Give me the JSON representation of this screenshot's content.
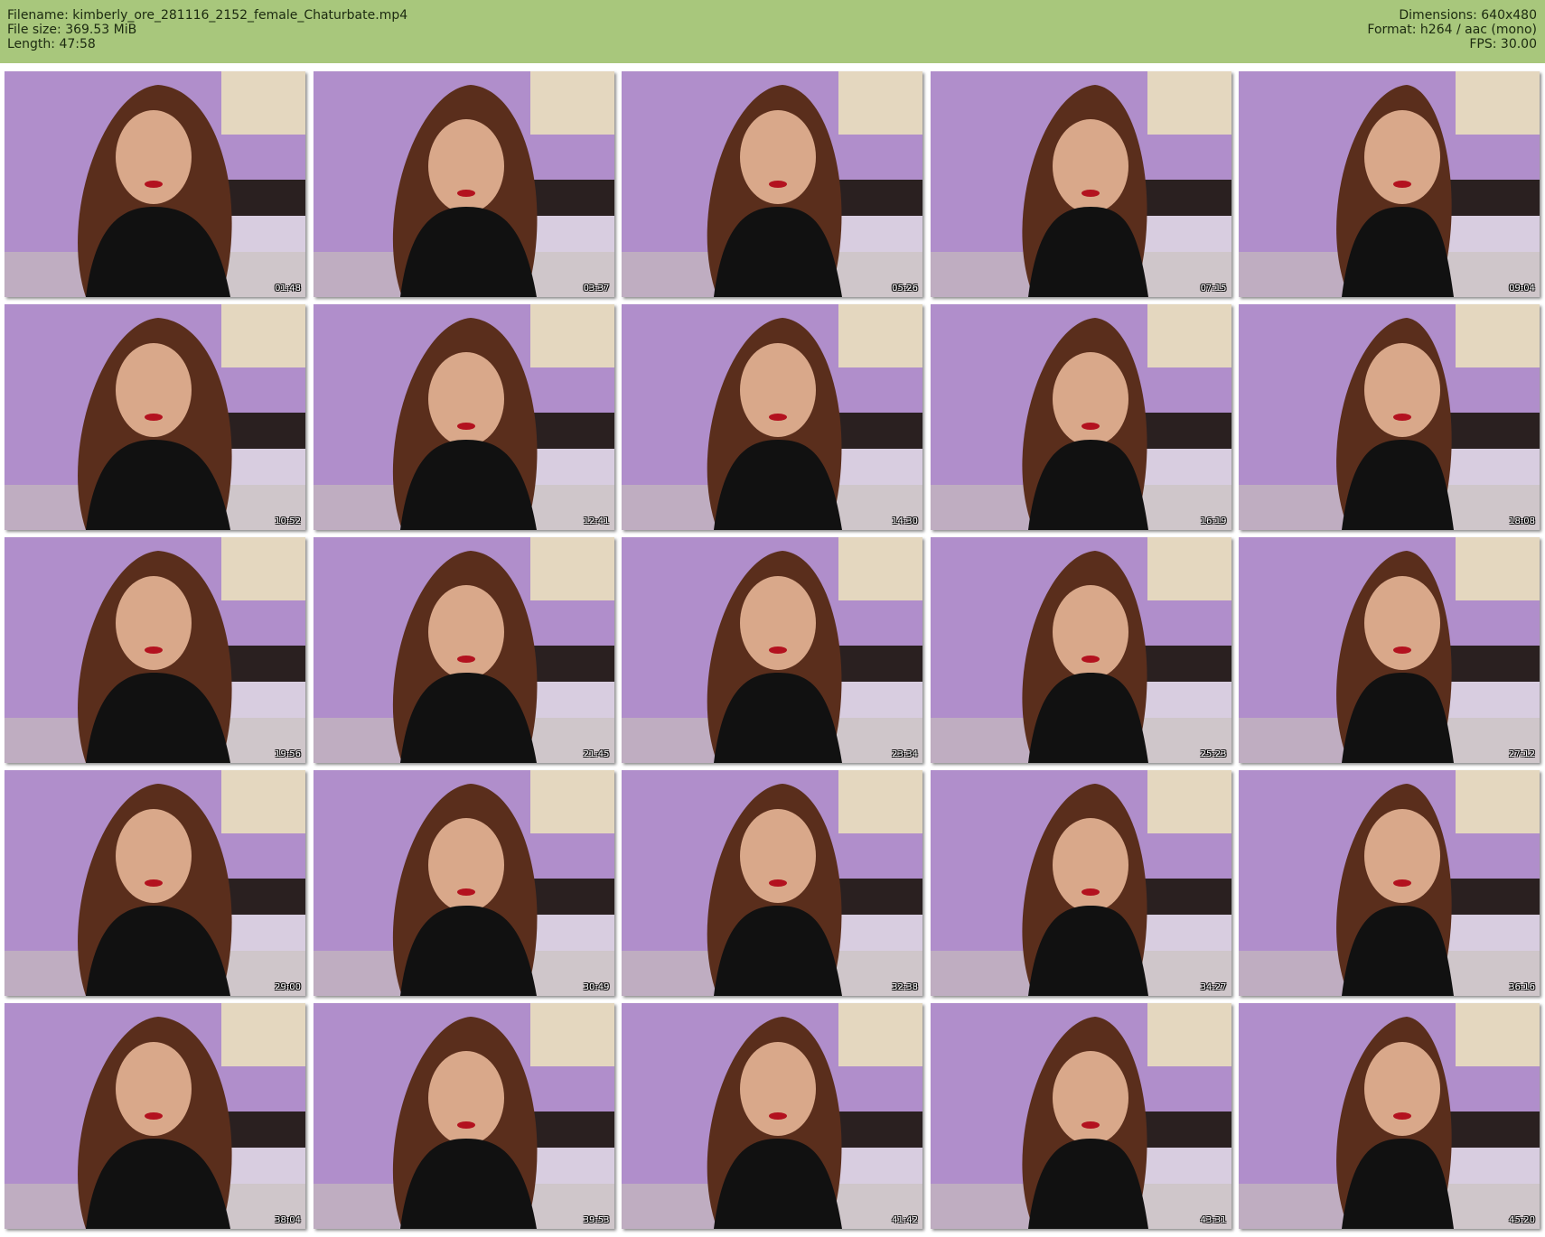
{
  "file_info": {
    "filename_line": "Filename: kimberly_ore_281116_2152_female_Chaturbate.mp4",
    "filesize_line": "File size: 369.53 MiB",
    "length_line": "Length: 47:58",
    "dimensions_line": "Dimensions: 640x480",
    "format_line": "Format: h264 / aac (mono)",
    "fps_line": "FPS: 30.00"
  },
  "colors": {
    "header_bg": "#a8c77c",
    "page_bg": "#ffffff",
    "wall": "#b08ecb",
    "hair": "#5a2e1c",
    "shirt": "#111111"
  },
  "thumbnails": [
    {
      "time": "01:48"
    },
    {
      "time": "03:37"
    },
    {
      "time": "05:26"
    },
    {
      "time": "07:15"
    },
    {
      "time": "09:04"
    },
    {
      "time": "10:52"
    },
    {
      "time": "12:41"
    },
    {
      "time": "14:30"
    },
    {
      "time": "16:19"
    },
    {
      "time": "18:08"
    },
    {
      "time": "19:56"
    },
    {
      "time": "21:45"
    },
    {
      "time": "23:34"
    },
    {
      "time": "25:23"
    },
    {
      "time": "27:12"
    },
    {
      "time": "29:00"
    },
    {
      "time": "30:49"
    },
    {
      "time": "32:38"
    },
    {
      "time": "34:27"
    },
    {
      "time": "36:16"
    },
    {
      "time": "38:04"
    },
    {
      "time": "39:53"
    },
    {
      "time": "41:42"
    },
    {
      "time": "43:31"
    },
    {
      "time": "45:20"
    }
  ]
}
